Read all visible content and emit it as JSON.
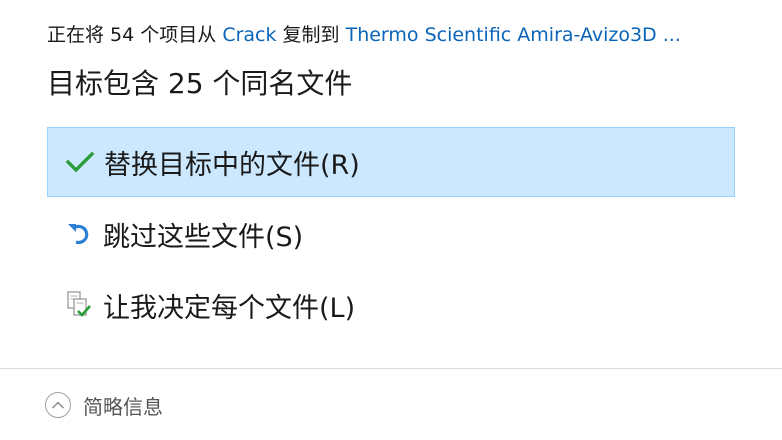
{
  "copy_status": {
    "prefix": "正在将 ",
    "count": "54",
    "middle": " 个项目从 ",
    "source": "Crack",
    "connector": " 复制到 ",
    "destination": "Thermo Scientific Amira-Avizo3D ..."
  },
  "heading": "目标包含 25 个同名文件",
  "options": [
    {
      "label": "替换目标中的文件(R)",
      "icon": "checkmark-icon",
      "selected": true
    },
    {
      "label": "跳过这些文件(S)",
      "icon": "undo-arrow-icon",
      "selected": false
    },
    {
      "label": "让我决定每个文件(L)",
      "icon": "compare-files-icon",
      "selected": false
    }
  ],
  "footer": {
    "label": "简略信息",
    "icon": "chevron-up-icon"
  },
  "colors": {
    "link": "#0a64b8",
    "selected_bg": "#cce8ff",
    "selected_border": "#99d1ff",
    "check_green": "#2a9d3a",
    "skip_blue": "#2b7fd4"
  }
}
